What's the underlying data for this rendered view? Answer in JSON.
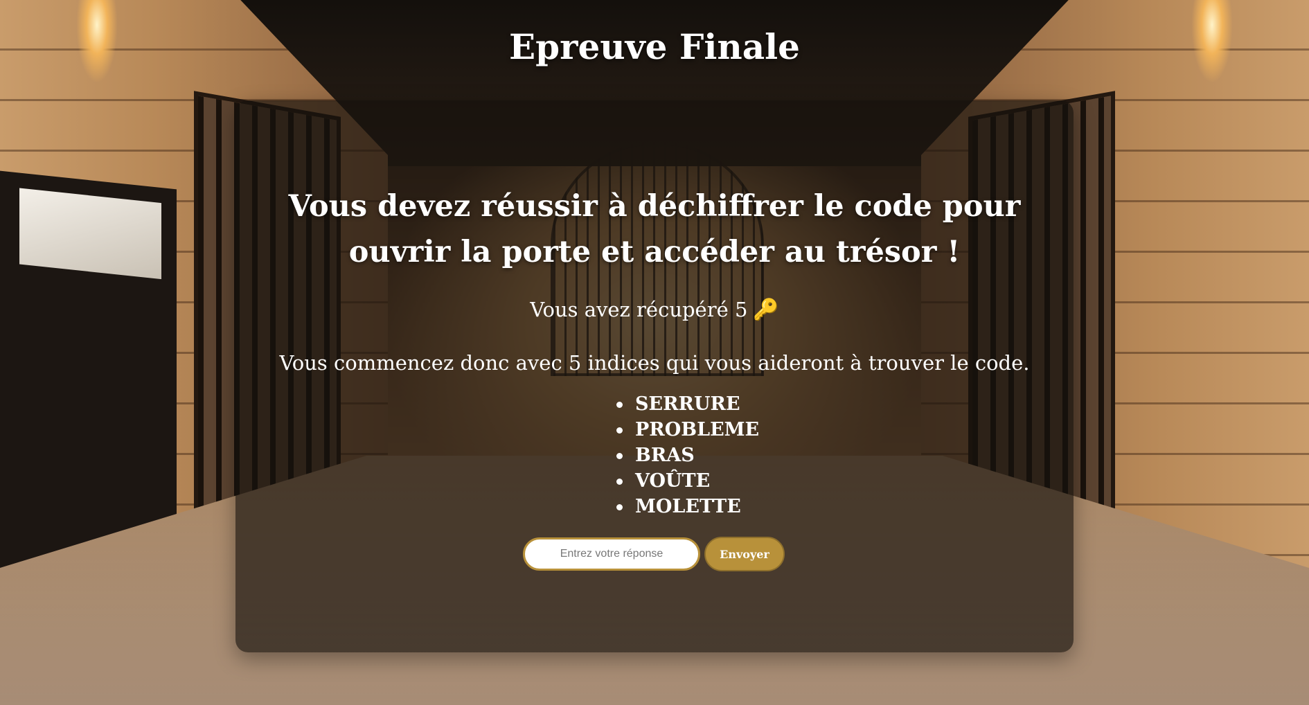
{
  "page": {
    "title": "Epreuve Finale"
  },
  "card": {
    "heading": "Vous devez réussir à déchiffrer le code pour ouvrir la porte et accéder au trésor !",
    "keys_text": "Vous avez récupéré 5",
    "key_icon": "🔑",
    "hints_intro": "Vous commencez donc avec 5 indices qui vous aideront à trouver le code.",
    "hints": [
      "SERRURE",
      "PROBLEME",
      "BRAS",
      "VOÛTE",
      "MOLETTE"
    ]
  },
  "form": {
    "placeholder": "Entrez votre réponse",
    "value": "",
    "submit_label": "Envoyer"
  },
  "colors": {
    "accent": "#b8913a",
    "card_bg": "rgba(22,16,12,0.66)",
    "text": "#ffffff"
  }
}
